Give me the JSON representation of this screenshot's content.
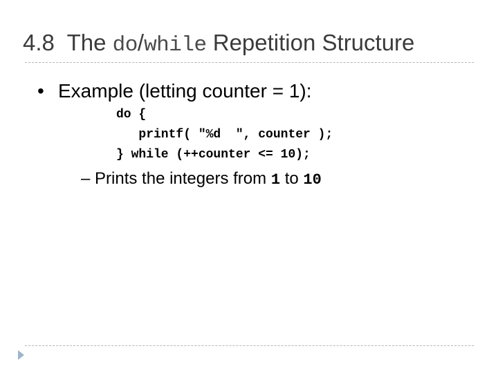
{
  "slide": {
    "title": {
      "number": "4.8",
      "prefix": "The",
      "code_do": "do",
      "slash": "/",
      "code_while": "while",
      "suffix": "Repetition Structure"
    },
    "bullet": {
      "symbol": "•",
      "text": "Example (letting counter = 1):"
    },
    "code_lines": [
      "do {",
      "   printf( \"%d  \", counter );",
      "} while (++counter <= 10);"
    ],
    "sub_bullet": {
      "dash": "–",
      "text_before": "Prints the integers from",
      "value_from": "1",
      "text_middle": "to",
      "value_to": "10"
    },
    "footer_icon": "triangle-right-icon",
    "colors": {
      "title": "#3b3b3b",
      "rule": "#b5b5b5",
      "footer_arrow": "#9fb4cc"
    }
  }
}
